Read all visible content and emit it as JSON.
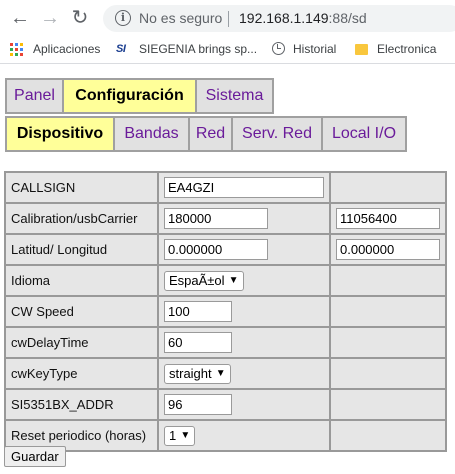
{
  "browser": {
    "security_text": "No es seguro",
    "url_host": "192.168.1.149",
    "url_rest": ":88/sd",
    "bookmarks": [
      {
        "label": "Aplicaciones"
      },
      {
        "label": "SIEGENIA brings sp...",
        "logo_text": "SI"
      },
      {
        "label": "Historial"
      },
      {
        "label": "Electronica"
      }
    ]
  },
  "main_tabs": [
    {
      "label": "Panel",
      "active": false
    },
    {
      "label": "Configuración",
      "active": true
    },
    {
      "label": "Sistema",
      "active": false
    }
  ],
  "sub_tabs": [
    {
      "label": "Dispositivo",
      "active": true
    },
    {
      "label": "Bandas",
      "active": false
    },
    {
      "label": "Red",
      "active": false
    },
    {
      "label": "Serv. Red",
      "active": false
    },
    {
      "label": "Local I/O",
      "active": false
    }
  ],
  "form": {
    "rows": [
      {
        "label": "CALLSIGN",
        "value": "EA4GZI"
      },
      {
        "label": "Calibration/usbCarrier",
        "value": "180000",
        "value2": "11056400"
      },
      {
        "label": "Latitud/ Longitud",
        "value": "0.000000",
        "value2": "0.000000"
      },
      {
        "label": "Idioma",
        "value": "EspaÃ±ol"
      },
      {
        "label": "CW Speed",
        "value": "100"
      },
      {
        "label": "cwDelayTime",
        "value": "60"
      },
      {
        "label": "cwKeyType",
        "value": "straight"
      },
      {
        "label": "SI5351BX_ADDR",
        "value": "96"
      },
      {
        "label": "Reset periodico (horas)",
        "value": "1"
      }
    ],
    "submit_label": "Guardar"
  },
  "colors": {
    "active_tab": "#ffff99",
    "inactive_tab": "#e1e1e1",
    "tab_text": "#6a1b9a",
    "link_label": "#1a3ca7"
  }
}
